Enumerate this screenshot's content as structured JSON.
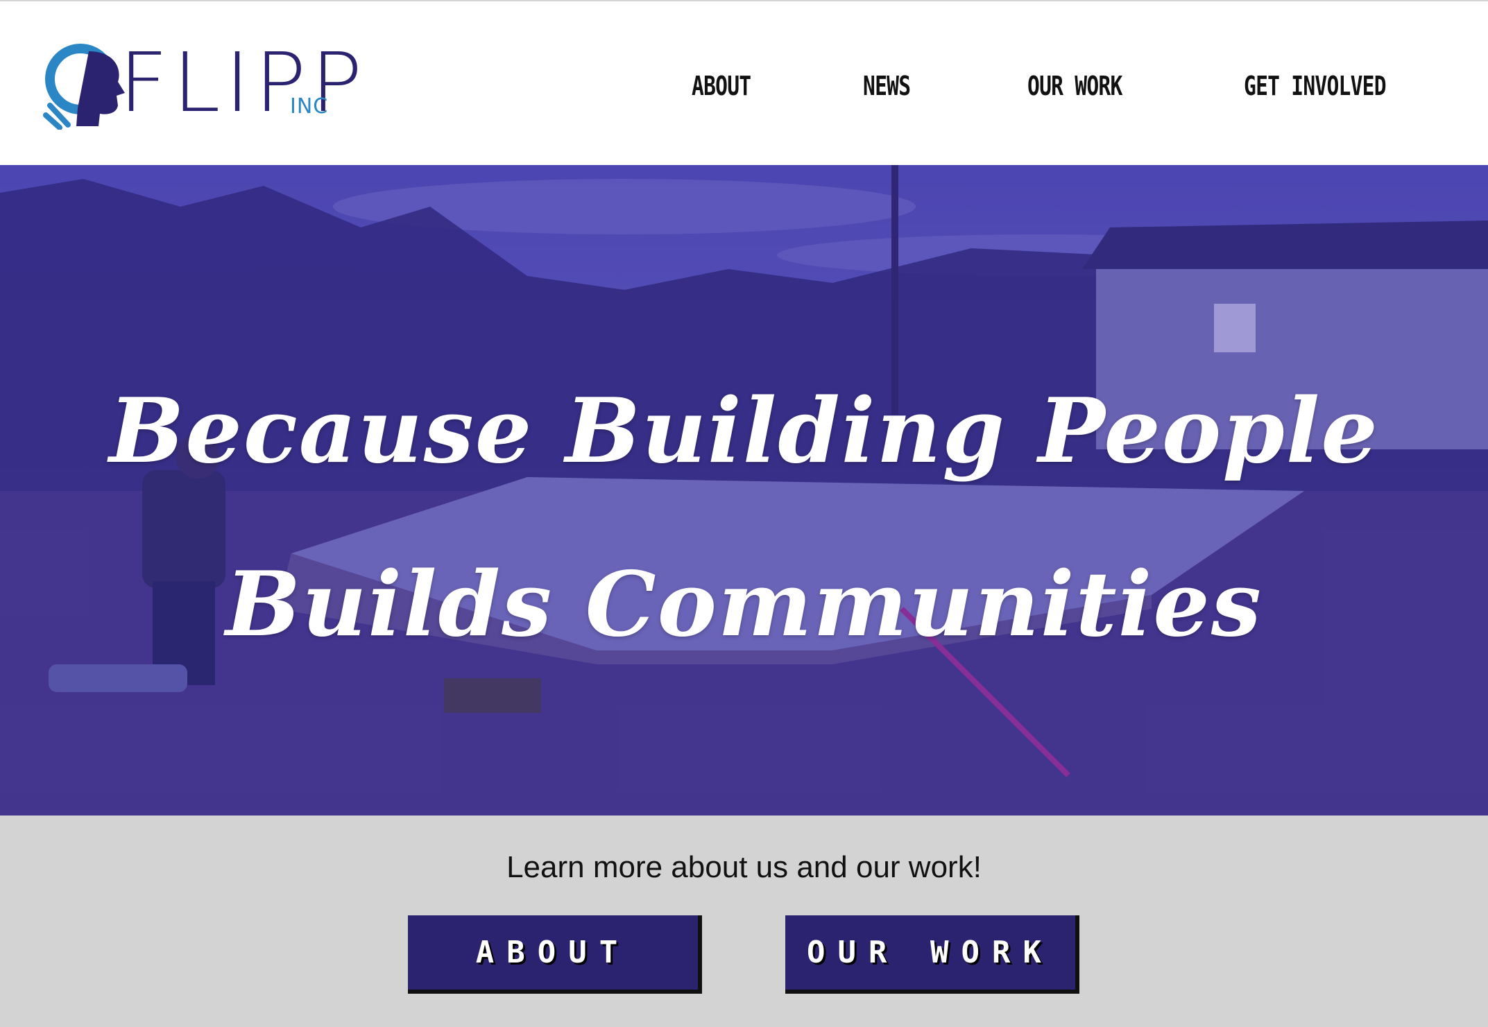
{
  "brand": {
    "logo_text": "FLIPP",
    "logo_suffix": "INC"
  },
  "nav": {
    "items": [
      {
        "label": "ABOUT"
      },
      {
        "label": "NEWS"
      },
      {
        "label": "OUR WORK"
      },
      {
        "label": "GET INVOLVED"
      }
    ]
  },
  "hero": {
    "headline_line1": "Because Building People",
    "headline_line2": "Builds Communities"
  },
  "cta_section": {
    "text": "Learn more about us and our work!",
    "buttons": [
      {
        "label": "ABOUT"
      },
      {
        "label": "OUR WORK"
      }
    ]
  },
  "colors": {
    "brand_navy": "#2b2370",
    "brand_blue": "#2b86c5",
    "band_gray": "#d3d3d3",
    "button_bg": "#2b2270"
  }
}
